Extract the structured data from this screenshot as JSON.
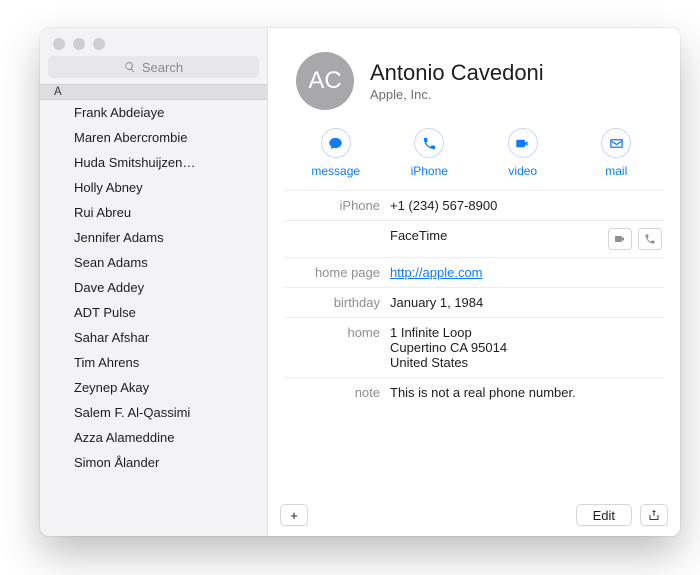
{
  "search": {
    "placeholder": "Search"
  },
  "sidebar": {
    "section_label": "A",
    "items": [
      "Frank Abdeiaye",
      "Maren Abercrombie",
      "Huda Smitshuijzen…",
      "Holly Abney",
      "Rui Abreu",
      "Jennifer Adams",
      "Sean Adams",
      "Dave Addey",
      "ADT Pulse",
      "Sahar Afshar",
      "Tim Ahrens",
      "Zeynep Akay",
      "Salem F. Al-Qassimi",
      "Azza Alameddine",
      "Simon Ålander"
    ]
  },
  "contact": {
    "initials": "AC",
    "name": "Antonio Cavedoni",
    "company": "Apple, Inc.",
    "actions": {
      "message": "message",
      "phone": "iPhone",
      "video": "video",
      "mail": "mail"
    },
    "fields": {
      "iphone_label": "iPhone",
      "iphone_value": "+1 (234) 567-8900",
      "facetime_label": "",
      "facetime_value": "FaceTime",
      "homepage_label": "home page",
      "homepage_value": "http://apple.com",
      "birthday_label": "birthday",
      "birthday_value": "January 1, 1984",
      "home_label": "home",
      "home_value": "1 Infinite Loop\nCupertino CA 95014\nUnited States",
      "note_label": "note",
      "note_value": "This is not a real phone number."
    }
  },
  "footer": {
    "add": "+",
    "edit": "Edit"
  }
}
